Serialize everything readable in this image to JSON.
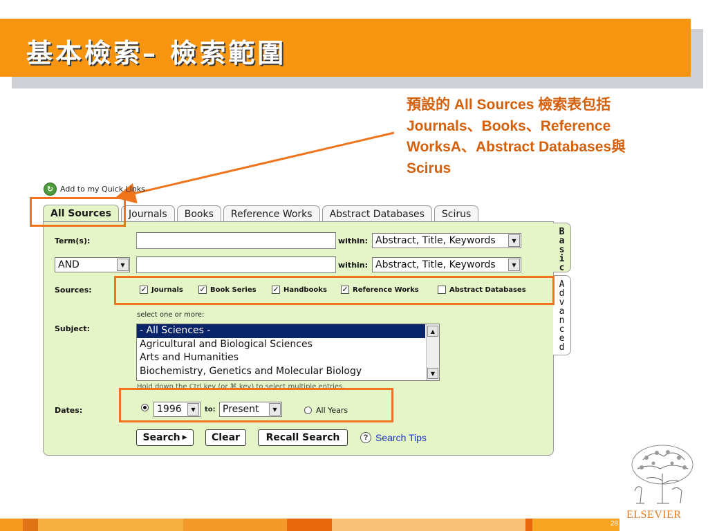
{
  "slide": {
    "title": "基本檢索– 檢索範圍",
    "callout": "預設的 All Sources 檢索表包括 Journals、Books、Reference WorksA、Abstract Databases與Scirus",
    "page_number": "28",
    "logo_text": "ELSEVIER"
  },
  "quick_links": {
    "label": "Add to my Quick Links",
    "icon": "quick-links-icon"
  },
  "tabs": [
    {
      "label": "All Sources",
      "active": true
    },
    {
      "label": "Journals"
    },
    {
      "label": "Books"
    },
    {
      "label": "Reference Works"
    },
    {
      "label": "Abstract Databases"
    },
    {
      "label": "Scirus"
    }
  ],
  "side_tabs": {
    "basic": "Basic",
    "advanced": "Advanced"
  },
  "form": {
    "terms_label": "Term(s):",
    "within_label": "within:",
    "within1_value": "Abstract, Title, Keywords",
    "within2_value": "Abstract, Title, Keywords",
    "operator_value": "AND",
    "term1_value": "",
    "term2_value": "",
    "sources_label": "Sources:",
    "sources": [
      {
        "label": "Journals",
        "checked": true
      },
      {
        "label": "Book Series",
        "checked": true
      },
      {
        "label": "Handbooks",
        "checked": true
      },
      {
        "label": "Reference Works",
        "checked": true
      },
      {
        "label": "Abstract Databases",
        "checked": false
      }
    ],
    "select_hint": "select one or more:",
    "subject_label": "Subject:",
    "subjects": [
      {
        "label": "- All Sciences -",
        "selected": true
      },
      {
        "label": "Agricultural and Biological Sciences"
      },
      {
        "label": "Arts and Humanities"
      },
      {
        "label": "Biochemistry, Genetics and Molecular Biology"
      }
    ],
    "ctrl_hint": "Hold down the Ctrl key (or ⌘ key) to select multiple entries.",
    "dates_label": "Dates:",
    "from_year": "1996",
    "to_label": "to:",
    "to_value": "Present",
    "all_years_label": "All Years",
    "date_range_selected": true
  },
  "buttons": {
    "search": "Search",
    "clear": "Clear",
    "recall": "Recall Search",
    "tips": "Search Tips"
  },
  "colors": {
    "title_bar": "#f79410",
    "callout_text": "#d4600b",
    "highlight": "#f0741c",
    "panel": "#e6f5c7",
    "link": "#1a33cc"
  }
}
